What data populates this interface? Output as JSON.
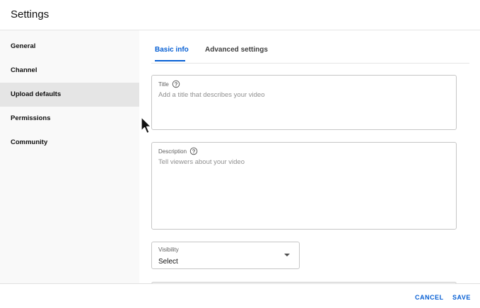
{
  "header": {
    "title": "Settings"
  },
  "sidebar": {
    "items": [
      {
        "label": "General"
      },
      {
        "label": "Channel"
      },
      {
        "label": "Upload defaults"
      },
      {
        "label": "Permissions"
      },
      {
        "label": "Community"
      }
    ],
    "active_index": 2
  },
  "tabs": [
    {
      "label": "Basic info"
    },
    {
      "label": "Advanced settings"
    }
  ],
  "form": {
    "title": {
      "label": "Title",
      "placeholder": "Add a title that describes your video"
    },
    "description": {
      "label": "Description",
      "placeholder": "Tell viewers about your video"
    },
    "visibility": {
      "label": "Visibility",
      "value": "Select"
    }
  },
  "footer": {
    "cancel_label": "CANCEL",
    "save_label": "SAVE"
  },
  "colors": {
    "accent": "#065fd4",
    "sidebar_active": "#e5e5e5",
    "sidebar_bg": "#f9f9f9"
  }
}
